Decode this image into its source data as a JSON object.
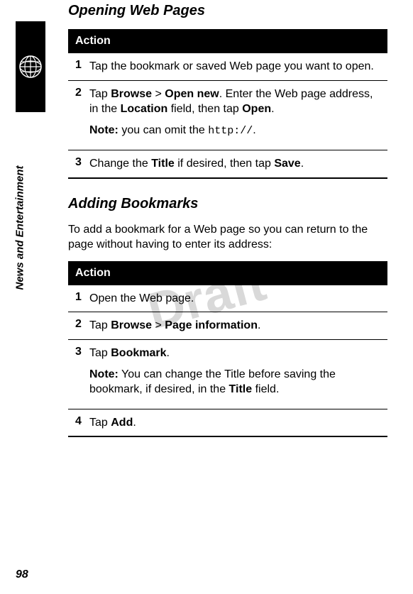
{
  "sidebar": {
    "section_label": "News and Entertainment",
    "icon": "globe-icon"
  },
  "watermark": "Draft",
  "page_number": "98",
  "sections": [
    {
      "heading": "Opening Web Pages",
      "table_header": "Action",
      "steps": [
        {
          "num": "1",
          "text_plain": "Tap the bookmark or saved Web page you want to open."
        },
        {
          "num": "2",
          "prefix": "Tap ",
          "cond1": "Browse",
          "sep": " > ",
          "cond2": "Open new",
          "mid": ". Enter the Web page address, in the ",
          "cond3": "Location",
          "mid2": " field, then tap ",
          "cond4": "Open",
          "suffix": ".",
          "note_label": "Note:",
          "note_text": " you can omit the ",
          "note_mono": "http://",
          "note_suffix": "."
        },
        {
          "num": "3",
          "prefix": "Change the ",
          "cond1": "Title",
          "mid": " if desired, then tap ",
          "cond2": "Save",
          "suffix": "."
        }
      ]
    },
    {
      "heading": "Adding Bookmarks",
      "intro": "To add a bookmark for a Web page so you can return to the page without having to enter its address:",
      "table_header": "Action",
      "steps": [
        {
          "num": "1",
          "text_plain": "Open the Web page."
        },
        {
          "num": "2",
          "prefix": "Tap ",
          "cond1": "Browse",
          "sep": " > ",
          "cond2": "Page information",
          "suffix": "."
        },
        {
          "num": "3",
          "prefix": "Tap ",
          "cond1": "Bookmark",
          "suffix": ".",
          "note_label": "Note:",
          "note_text": " You can change the Title before saving the bookmark, if desired, in the ",
          "note_cond": "Title",
          "note_suffix": " field."
        },
        {
          "num": "4",
          "prefix": "Tap ",
          "cond1": "Add",
          "suffix": "."
        }
      ]
    }
  ]
}
